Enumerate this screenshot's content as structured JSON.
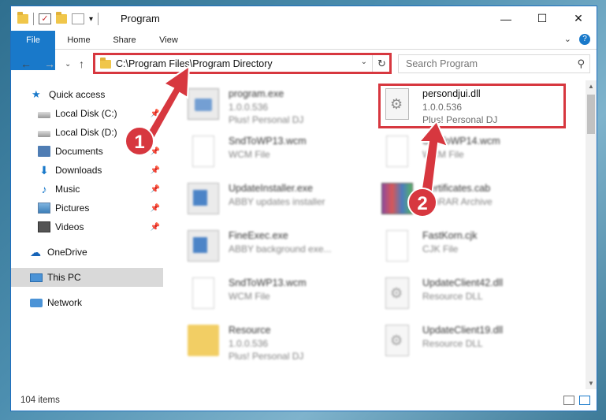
{
  "window": {
    "title": "Program",
    "controls": {
      "minimize": "—",
      "maximize": "☐",
      "close": "✕"
    }
  },
  "ribbon": {
    "tabs": [
      "File",
      "Home",
      "Share",
      "View"
    ],
    "expand": "⌄",
    "help": "?"
  },
  "nav": {
    "back": "←",
    "forward": "→",
    "recent": "⌄",
    "up": "↑"
  },
  "address": {
    "path": "C:\\Program Files\\Program Directory",
    "dropdown": "⌄",
    "refresh": "↻"
  },
  "search": {
    "placeholder": "Search Program",
    "icon": "search-icon"
  },
  "sidebar": {
    "items": [
      {
        "label": "Quick access",
        "icon": "star-icon",
        "pinned": false
      },
      {
        "label": "Local Disk (C:)",
        "icon": "disk-icon",
        "pinned": true
      },
      {
        "label": "Local Disk (D:)",
        "icon": "disk-icon",
        "pinned": true
      },
      {
        "label": "Documents",
        "icon": "documents-icon",
        "pinned": true
      },
      {
        "label": "Downloads",
        "icon": "downloads-icon",
        "pinned": true
      },
      {
        "label": "Music",
        "icon": "music-icon",
        "pinned": true
      },
      {
        "label": "Pictures",
        "icon": "pictures-icon",
        "pinned": true
      },
      {
        "label": "Videos",
        "icon": "videos-icon",
        "pinned": true
      },
      {
        "label": "OneDrive",
        "icon": "onedrive-icon",
        "pinned": false
      },
      {
        "label": "This PC",
        "icon": "pc-icon",
        "pinned": false,
        "selected": true
      },
      {
        "label": "Network",
        "icon": "network-icon",
        "pinned": false
      }
    ],
    "pin_glyph": "📌"
  },
  "files": [
    {
      "name": "program.exe",
      "line1": "1.0.0.536",
      "line2": "Plus! Personal DJ",
      "kind": "program"
    },
    {
      "name": "persondjui.dll",
      "line1": "1.0.0.536",
      "line2": "Plus! Personal DJ",
      "kind": "dll",
      "highlighted": true
    },
    {
      "name": "SndToWP13.wcm",
      "line1": "WCM File",
      "line2": "",
      "kind": "doc"
    },
    {
      "name": "SndToWP14.wcm",
      "line1": "WCM File",
      "line2": "",
      "kind": "doc"
    },
    {
      "name": "UpdateInstaller.exe",
      "line1": "ABBY updates installer",
      "line2": "",
      "kind": "exe"
    },
    {
      "name": "Certificates.cab",
      "line1": "WinRAR Archive",
      "line2": "",
      "kind": "rar"
    },
    {
      "name": "FineExec.exe",
      "line1": "ABBY background exe...",
      "line2": "",
      "kind": "exe"
    },
    {
      "name": "FastKorn.cjk",
      "line1": "CJK File",
      "line2": "",
      "kind": "doc"
    },
    {
      "name": "SndToWP13.wcm",
      "line1": "WCM File",
      "line2": "",
      "kind": "doc"
    },
    {
      "name": "UpdateClient42.dll",
      "line1": "Resource DLL",
      "line2": "",
      "kind": "dll"
    },
    {
      "name": "Resource",
      "line1": "1.0.0.536",
      "line2": "Plus! Personal DJ",
      "kind": "folder"
    },
    {
      "name": "UpdateClient19.dll",
      "line1": "Resource DLL",
      "line2": "",
      "kind": "dll"
    }
  ],
  "callouts": [
    "1",
    "2"
  ],
  "status": {
    "count": "104 items"
  },
  "colors": {
    "accent": "#1979ca",
    "highlight": "#d7373f"
  }
}
